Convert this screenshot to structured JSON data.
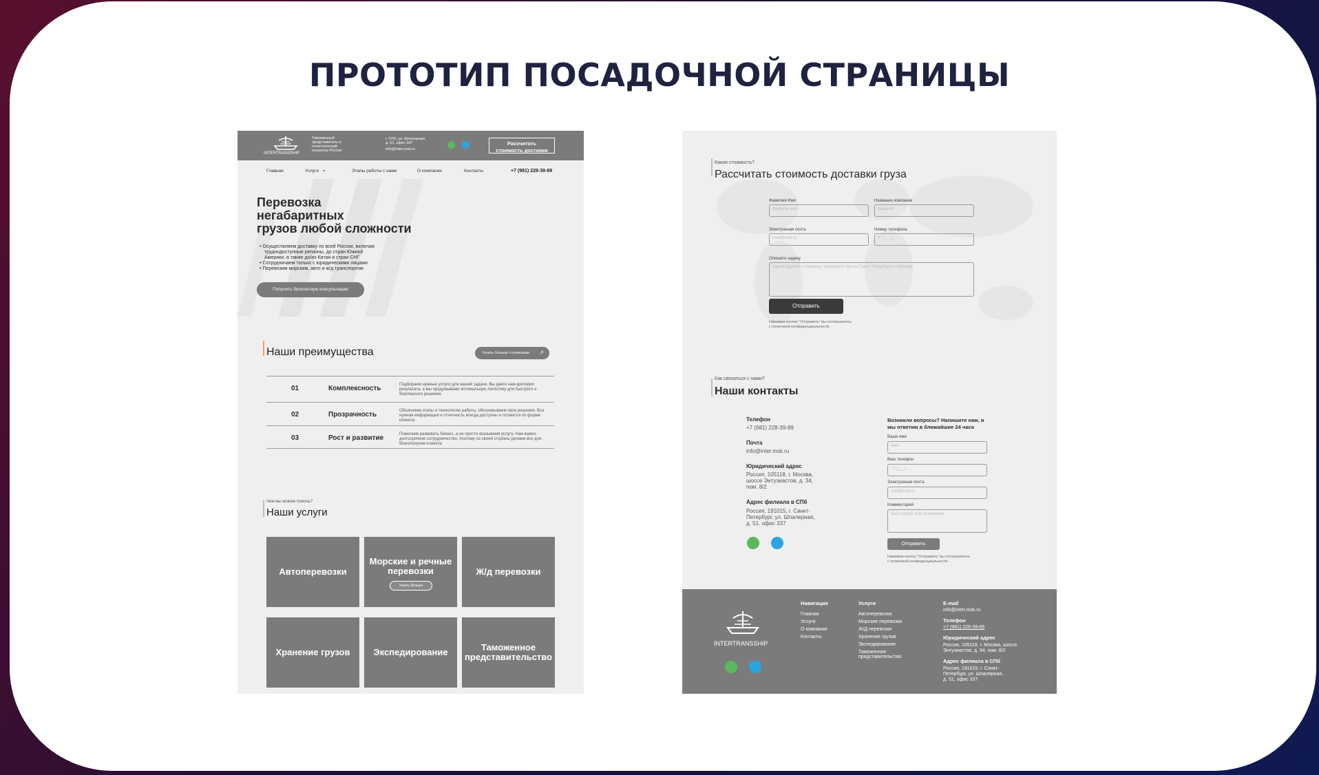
{
  "slide": {
    "title": "ПРОТОТИП ПОСАДОЧНОЙ СТРАНИЦЫ"
  },
  "left": {
    "header": {
      "logo_text": "INTERTRANSSHIP",
      "tagline": [
        "Таможенный",
        "представитель и",
        "логистический",
        "оператор России"
      ],
      "address": [
        "г. СПб, ул. Шпалерная,",
        "д. 51, офис 337"
      ],
      "email": "info@inter.msk.ru",
      "cta": [
        "Рассчитать",
        "стоимость доставки"
      ]
    },
    "nav": {
      "items": [
        "Главная",
        "Услуги",
        "Этапы работы с нами",
        "О компании",
        "Контакты"
      ],
      "phone": "+7 (981) 229-39-89"
    },
    "hero": {
      "title": [
        "Перевозка",
        "негабаритных",
        "грузов любой сложности"
      ],
      "bullets": [
        "Осуществляем доставку по всей России, включая",
        "труднодоступные регионы, до стран Южной",
        "Америки, а также до/из Китая и стран СНГ",
        "Сотрудничаем только с юридическими лицами",
        "Перевозим морским, авто и ж/д транспортом"
      ],
      "button": "Получить бесплатную консультацию"
    },
    "advantages": {
      "title": "Наши преимущества",
      "more_button": "Узнать больше о компании",
      "rows": [
        {
          "num": "01",
          "name": "Комплексность",
          "desc": "Подбираем нужные услуги для вашей задачи. Вы даете нам критерии результата, а мы продумываем оптимальную логистику для быстрого и безопасного решения"
        },
        {
          "num": "02",
          "name": "Прозрачность",
          "desc": "Объясняем этапы и технологию работы, обосновываем свои решения. Вся нужная информация и отчетность всегда доступны и готовятся по форме клиента"
        },
        {
          "num": "03",
          "name": "Рост и развитие",
          "desc": "Помогаем развивать бизнес, а не просто оказываем услугу. Нам важно долгосрочное сотрудничество, поэтому со своей стороны делаем все для благополучия клиента"
        }
      ]
    },
    "services": {
      "eyebrow": "Чем мы можем помочь?",
      "title": "Наши услуги",
      "items": [
        "Автоперевозки",
        "Морские и речные перевозки",
        "Ж/д перевозки",
        "Хранение грузов",
        "Экспедирование",
        "Таможенное представительство"
      ],
      "more_button": "Узнать больше"
    }
  },
  "right": {
    "calc": {
      "eyebrow": "Какая стоимость?",
      "title": "Рассчитать стоимость доставки груза",
      "fields": [
        {
          "label": "Фамилия Имя",
          "placeholder": "Введите имя"
        },
        {
          "label": "Название компании",
          "placeholder": "Введите"
        },
        {
          "label": "Электронная почта",
          "placeholder": "mail@mail.ru"
        },
        {
          "label": "Номер телефона",
          "placeholder": "+7 (___)"
        }
      ],
      "task_label": "Опишите задачу",
      "task_placeholder": "Одной фразой, к примеру: перевезти груз из Санкт-Петербурга в Москву",
      "submit": "Отправить",
      "consent": [
        "Нажимая кнопку \"Отправить\" вы соглашаетесь",
        "с политикой конфиденциальности"
      ]
    },
    "contacts": {
      "eyebrow": "Как связаться с нами?",
      "title": "Наши контакты",
      "phone_label": "Телефон",
      "phone": "+7 (981) 228-39-89",
      "mail_label": "Почта",
      "mail": "info@inter.msk.ru",
      "legal_label": "Юридический адрес",
      "legal": [
        "Россия, 105118, г. Москва,",
        "шоссе Энтузиастов, д. 34,",
        "пом. 8/2"
      ],
      "branch_label": "Адрес филиала в СПб",
      "branch": [
        "Россия, 191015, г. Санкт-",
        "Петербург, ул. Шпалерная,",
        "д. 51, офис 337"
      ],
      "form_title": [
        "Возникли вопросы? Напишите нам, и",
        "мы ответим в ближайшие 24 часа"
      ],
      "form_fields": [
        {
          "label": "Ваше имя",
          "placeholder": "Имя"
        },
        {
          "label": "Ваш телефон",
          "placeholder": "+7 (___)"
        },
        {
          "label": "Электронная почта",
          "placeholder": "mail@mail.ru"
        },
        {
          "label": "Комментарий",
          "placeholder": "Ваш вопрос или пожелание"
        }
      ],
      "submit": "Отправить",
      "consent": [
        "Нажимая кнопку \"Отправить\" вы соглашаетесь",
        "с политикой конфиденциальности"
      ]
    },
    "footer": {
      "logo_text": "INTERTRANSSHIP",
      "nav_title": "Навигация",
      "nav": [
        "Главная",
        "Услуги",
        "О компании",
        "Контакты"
      ],
      "svc_title": "Услуги",
      "svc": [
        "Автоперевозки",
        "Морские перевозки",
        "Ж/Д перевозки",
        "Хранение грузов",
        "Экспедирование",
        "Таможенное",
        "представительство"
      ],
      "email_label": "E-mail",
      "email": "info@inter.msk.ru",
      "phone_label": "Телефон",
      "phone": "+7 (981) 228-39-89",
      "legal_label": "Юридический адрес",
      "legal": [
        "Россия, 105118, г. Москва, шоссе",
        "Энтузиастов, д. 34, пом. 8/2"
      ],
      "branch_label": "Адрес филиала в СПб",
      "branch": [
        "Россия, 191015, г. Санкт-",
        "Петербург, ул. Шпалерная,",
        "д. 51, офис 337"
      ]
    }
  },
  "colors": {
    "header_gray": "#7b7b7b",
    "page_gray": "#efefef",
    "accent_orange": "#e8a070",
    "whatsapp": "#5bb85e",
    "telegram": "#2aa5e0",
    "title_navy": "#1f2340"
  }
}
